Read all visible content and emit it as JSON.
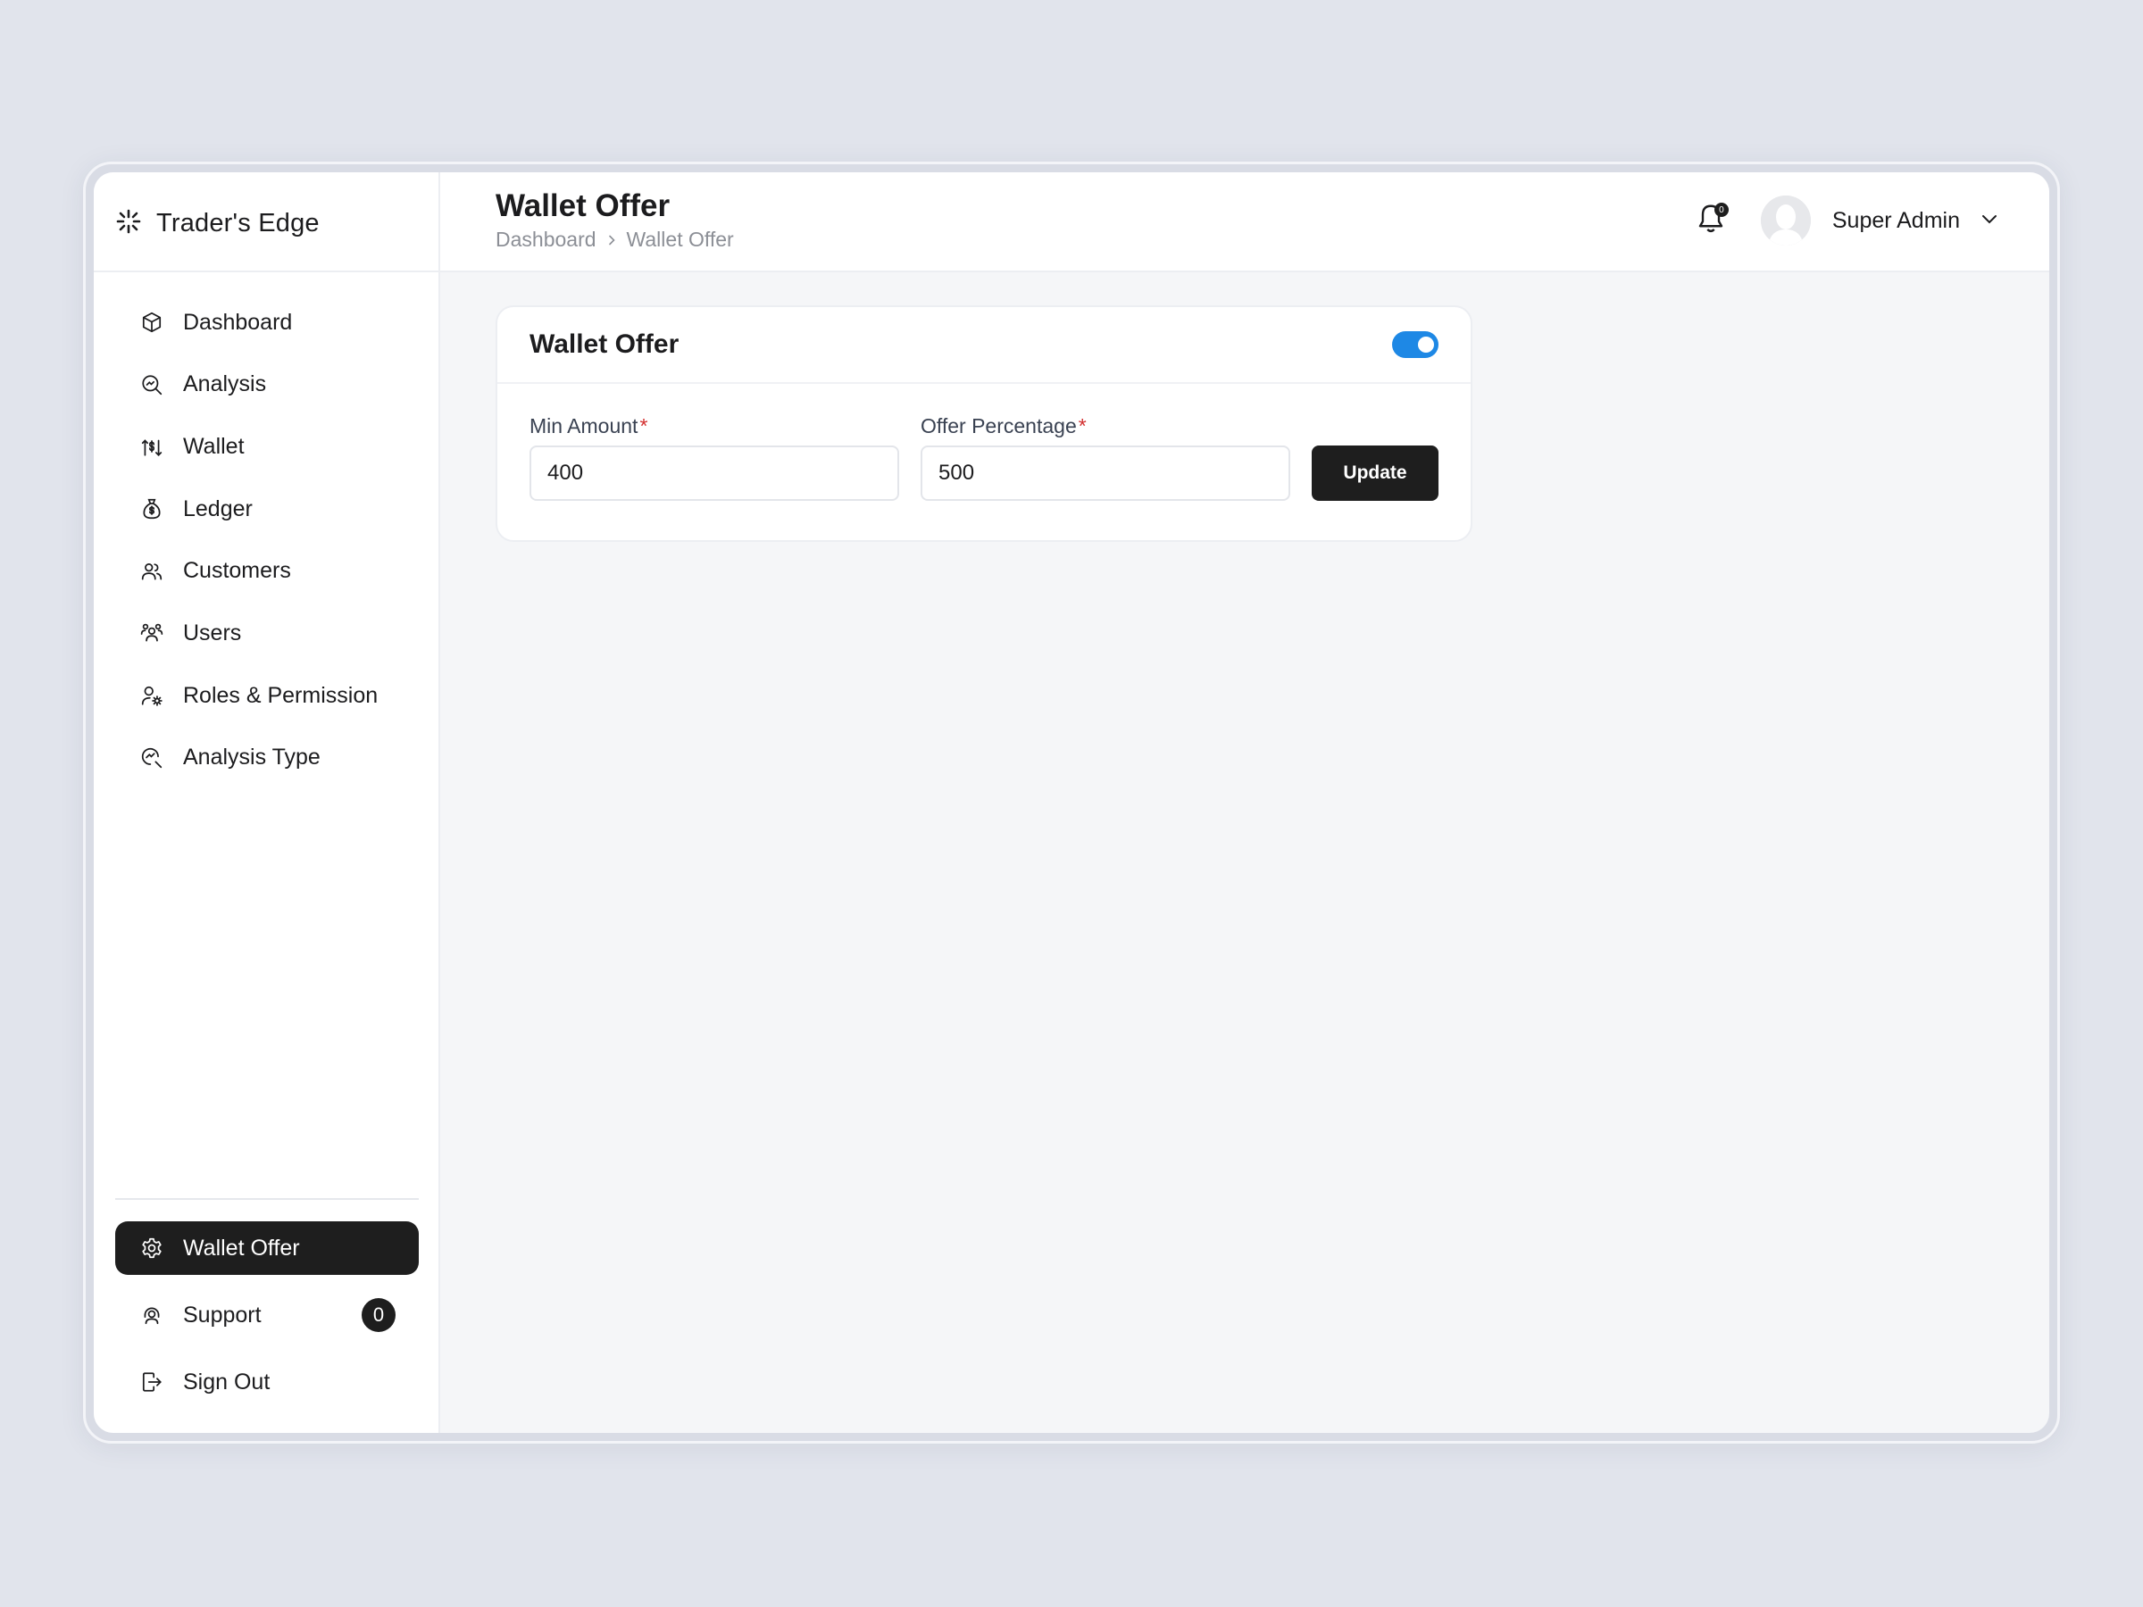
{
  "app": {
    "name": "Trader's Edge"
  },
  "sidebar": {
    "items": [
      {
        "label": "Dashboard",
        "icon": "cube-icon"
      },
      {
        "label": "Analysis",
        "icon": "analysis-search-icon"
      },
      {
        "label": "Wallet",
        "icon": "wallet-exchange-icon"
      },
      {
        "label": "Ledger",
        "icon": "money-bag-icon"
      },
      {
        "label": "Customers",
        "icon": "customers-icon"
      },
      {
        "label": "Users",
        "icon": "users-group-icon"
      },
      {
        "label": "Roles & Permission",
        "icon": "user-gear-icon"
      },
      {
        "label": "Analysis Type",
        "icon": "analysis-type-icon"
      }
    ],
    "bottom_items": [
      {
        "label": "Wallet Offer",
        "icon": "gear-icon",
        "active": true
      },
      {
        "label": "Support",
        "icon": "support-icon",
        "badge": "0"
      },
      {
        "label": "Sign Out",
        "icon": "sign-out-icon"
      }
    ]
  },
  "header": {
    "title": "Wallet Offer",
    "breadcrumb": [
      "Dashboard",
      "Wallet Offer"
    ],
    "notification_count": "0",
    "user_name": "Super Admin"
  },
  "card": {
    "title": "Wallet Offer",
    "toggle_on": true,
    "min_amount": {
      "label": "Min Amount",
      "value": "400"
    },
    "offer_percentage": {
      "label": "Offer Percentage",
      "value": "500"
    },
    "update_label": "Update"
  },
  "colors": {
    "accent": "#1e88e5",
    "dark": "#1e1e1e",
    "required": "#d32f2f"
  }
}
